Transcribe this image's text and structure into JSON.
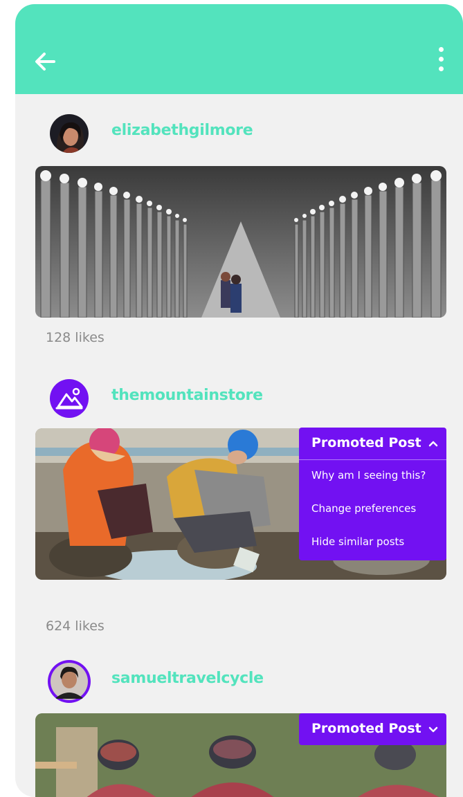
{
  "header": {
    "back_icon": "arrow-left-icon",
    "menu_icon": "more-vertical-icon",
    "color": "#53e3bd"
  },
  "posts": [
    {
      "username": "elizabethgilmore",
      "likes": "128 likes",
      "image": "urban-light-lamp-posts-couple"
    },
    {
      "username": "themountainstore",
      "likes": "624 likes",
      "image": "hikers-crouching-by-stream",
      "promo": {
        "label": "Promoted Post",
        "expanded": true,
        "options": [
          "Why am I seeing this?",
          "Change preferences",
          "Hide similar posts"
        ]
      }
    },
    {
      "username": "samueltravelcycle",
      "image": "cyclists-on-road",
      "promo": {
        "label": "Promoted Post",
        "expanded": false
      }
    }
  ],
  "colors": {
    "accent": "#53e3bd",
    "promo": "#7211f2",
    "background": "#f1f1f1"
  }
}
